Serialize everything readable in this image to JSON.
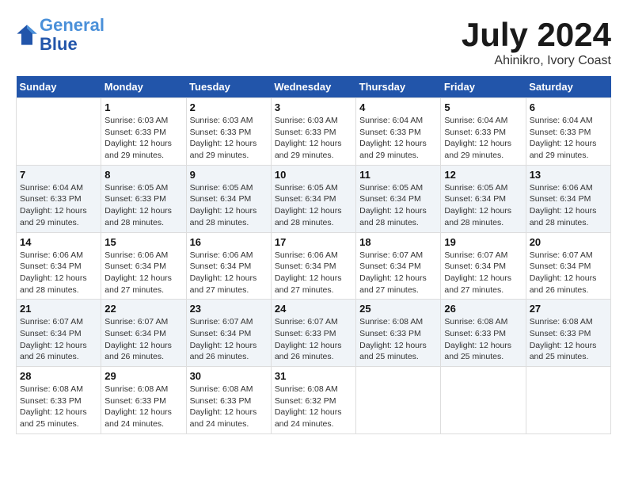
{
  "header": {
    "logo_line1": "General",
    "logo_line2": "Blue",
    "month_title": "July 2024",
    "subtitle": "Ahinikro, Ivory Coast"
  },
  "days_of_week": [
    "Sunday",
    "Monday",
    "Tuesday",
    "Wednesday",
    "Thursday",
    "Friday",
    "Saturday"
  ],
  "weeks": [
    [
      {
        "day": "",
        "info": ""
      },
      {
        "day": "1",
        "info": "Sunrise: 6:03 AM\nSunset: 6:33 PM\nDaylight: 12 hours\nand 29 minutes."
      },
      {
        "day": "2",
        "info": "Sunrise: 6:03 AM\nSunset: 6:33 PM\nDaylight: 12 hours\nand 29 minutes."
      },
      {
        "day": "3",
        "info": "Sunrise: 6:03 AM\nSunset: 6:33 PM\nDaylight: 12 hours\nand 29 minutes."
      },
      {
        "day": "4",
        "info": "Sunrise: 6:04 AM\nSunset: 6:33 PM\nDaylight: 12 hours\nand 29 minutes."
      },
      {
        "day": "5",
        "info": "Sunrise: 6:04 AM\nSunset: 6:33 PM\nDaylight: 12 hours\nand 29 minutes."
      },
      {
        "day": "6",
        "info": "Sunrise: 6:04 AM\nSunset: 6:33 PM\nDaylight: 12 hours\nand 29 minutes."
      }
    ],
    [
      {
        "day": "7",
        "info": "Sunrise: 6:04 AM\nSunset: 6:33 PM\nDaylight: 12 hours\nand 29 minutes."
      },
      {
        "day": "8",
        "info": "Sunrise: 6:05 AM\nSunset: 6:33 PM\nDaylight: 12 hours\nand 28 minutes."
      },
      {
        "day": "9",
        "info": "Sunrise: 6:05 AM\nSunset: 6:34 PM\nDaylight: 12 hours\nand 28 minutes."
      },
      {
        "day": "10",
        "info": "Sunrise: 6:05 AM\nSunset: 6:34 PM\nDaylight: 12 hours\nand 28 minutes."
      },
      {
        "day": "11",
        "info": "Sunrise: 6:05 AM\nSunset: 6:34 PM\nDaylight: 12 hours\nand 28 minutes."
      },
      {
        "day": "12",
        "info": "Sunrise: 6:05 AM\nSunset: 6:34 PM\nDaylight: 12 hours\nand 28 minutes."
      },
      {
        "day": "13",
        "info": "Sunrise: 6:06 AM\nSunset: 6:34 PM\nDaylight: 12 hours\nand 28 minutes."
      }
    ],
    [
      {
        "day": "14",
        "info": "Sunrise: 6:06 AM\nSunset: 6:34 PM\nDaylight: 12 hours\nand 28 minutes."
      },
      {
        "day": "15",
        "info": "Sunrise: 6:06 AM\nSunset: 6:34 PM\nDaylight: 12 hours\nand 27 minutes."
      },
      {
        "day": "16",
        "info": "Sunrise: 6:06 AM\nSunset: 6:34 PM\nDaylight: 12 hours\nand 27 minutes."
      },
      {
        "day": "17",
        "info": "Sunrise: 6:06 AM\nSunset: 6:34 PM\nDaylight: 12 hours\nand 27 minutes."
      },
      {
        "day": "18",
        "info": "Sunrise: 6:07 AM\nSunset: 6:34 PM\nDaylight: 12 hours\nand 27 minutes."
      },
      {
        "day": "19",
        "info": "Sunrise: 6:07 AM\nSunset: 6:34 PM\nDaylight: 12 hours\nand 27 minutes."
      },
      {
        "day": "20",
        "info": "Sunrise: 6:07 AM\nSunset: 6:34 PM\nDaylight: 12 hours\nand 26 minutes."
      }
    ],
    [
      {
        "day": "21",
        "info": "Sunrise: 6:07 AM\nSunset: 6:34 PM\nDaylight: 12 hours\nand 26 minutes."
      },
      {
        "day": "22",
        "info": "Sunrise: 6:07 AM\nSunset: 6:34 PM\nDaylight: 12 hours\nand 26 minutes."
      },
      {
        "day": "23",
        "info": "Sunrise: 6:07 AM\nSunset: 6:34 PM\nDaylight: 12 hours\nand 26 minutes."
      },
      {
        "day": "24",
        "info": "Sunrise: 6:07 AM\nSunset: 6:33 PM\nDaylight: 12 hours\nand 26 minutes."
      },
      {
        "day": "25",
        "info": "Sunrise: 6:08 AM\nSunset: 6:33 PM\nDaylight: 12 hours\nand 25 minutes."
      },
      {
        "day": "26",
        "info": "Sunrise: 6:08 AM\nSunset: 6:33 PM\nDaylight: 12 hours\nand 25 minutes."
      },
      {
        "day": "27",
        "info": "Sunrise: 6:08 AM\nSunset: 6:33 PM\nDaylight: 12 hours\nand 25 minutes."
      }
    ],
    [
      {
        "day": "28",
        "info": "Sunrise: 6:08 AM\nSunset: 6:33 PM\nDaylight: 12 hours\nand 25 minutes."
      },
      {
        "day": "29",
        "info": "Sunrise: 6:08 AM\nSunset: 6:33 PM\nDaylight: 12 hours\nand 24 minutes."
      },
      {
        "day": "30",
        "info": "Sunrise: 6:08 AM\nSunset: 6:33 PM\nDaylight: 12 hours\nand 24 minutes."
      },
      {
        "day": "31",
        "info": "Sunrise: 6:08 AM\nSunset: 6:32 PM\nDaylight: 12 hours\nand 24 minutes."
      },
      {
        "day": "",
        "info": ""
      },
      {
        "day": "",
        "info": ""
      },
      {
        "day": "",
        "info": ""
      }
    ]
  ]
}
